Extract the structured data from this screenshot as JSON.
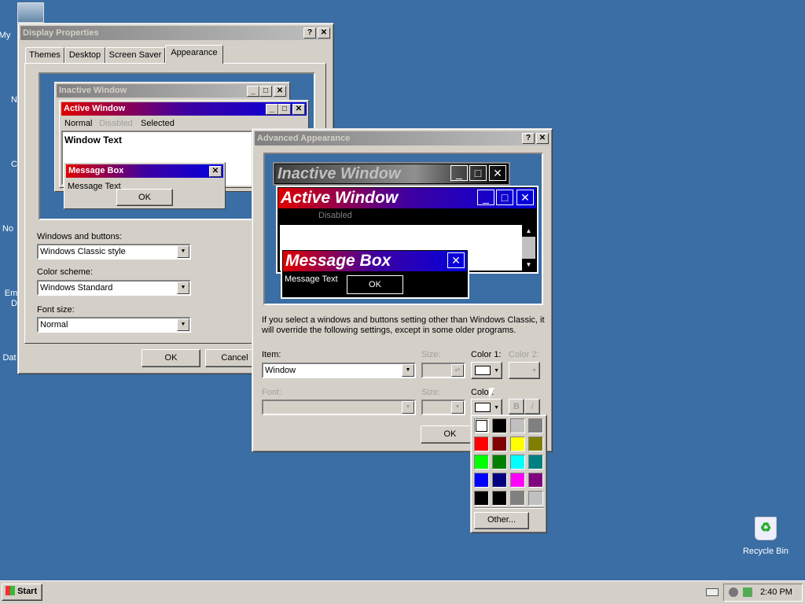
{
  "desktop": {
    "labels": [
      "My",
      "N",
      "C",
      "No",
      "Em",
      "D",
      "Dat"
    ],
    "recycle_bin": "Recycle Bin"
  },
  "display": {
    "title": "Display Properties",
    "help": "?",
    "close": "✕",
    "tabs": [
      "Themes",
      "Desktop",
      "Screen Saver",
      "Appearance"
    ],
    "preview": {
      "inactive": "Inactive Window",
      "active": "Active Window",
      "menu": [
        "Normal",
        "Disabled",
        "Selected"
      ],
      "window_text": "Window Text",
      "msgbox": "Message Box",
      "msg_text": "Message Text",
      "ok": "OK"
    },
    "windows_buttons_label": "Windows and buttons:",
    "windows_buttons_value": "Windows Classic style",
    "color_scheme_label": "Color scheme:",
    "color_scheme_value": "Windows Standard",
    "font_size_label": "Font size:",
    "font_size_value": "Normal",
    "ok": "OK",
    "cancel": "Cancel"
  },
  "advanced": {
    "title": "Advanced Appearance",
    "help": "?",
    "close": "✕",
    "preview": {
      "inactive": "Inactive Window",
      "active": "Active Window",
      "disabled": "Disabled",
      "msgbox": "Message Box",
      "msg_text": "Message Text",
      "ok": "OK"
    },
    "info": "If you select a windows and buttons setting other than Windows Classic, it will override the following settings, except in some older programs.",
    "item_label": "Item:",
    "item_value": "Window",
    "size_label": "Size:",
    "color1_label": "Color 1:",
    "color2_label": "Color 2:",
    "font_label": "Font:",
    "font_size_label": "Size:",
    "color_label": "Color:",
    "bold": "B",
    "italic": "I",
    "ok": "OK"
  },
  "palette": {
    "colors": [
      "#ffffff",
      "#000000",
      "#c0c0c0",
      "#808080",
      "#ff0000",
      "#800000",
      "#ffff00",
      "#808000",
      "#00ff00",
      "#008000",
      "#00ffff",
      "#008080",
      "#0000ff",
      "#000080",
      "#ff00ff",
      "#800080",
      "#000000",
      "#000000",
      "#808080",
      "#c0c0c0"
    ],
    "other": "Other..."
  },
  "taskbar": {
    "start": "Start",
    "time": "2:40 PM"
  }
}
